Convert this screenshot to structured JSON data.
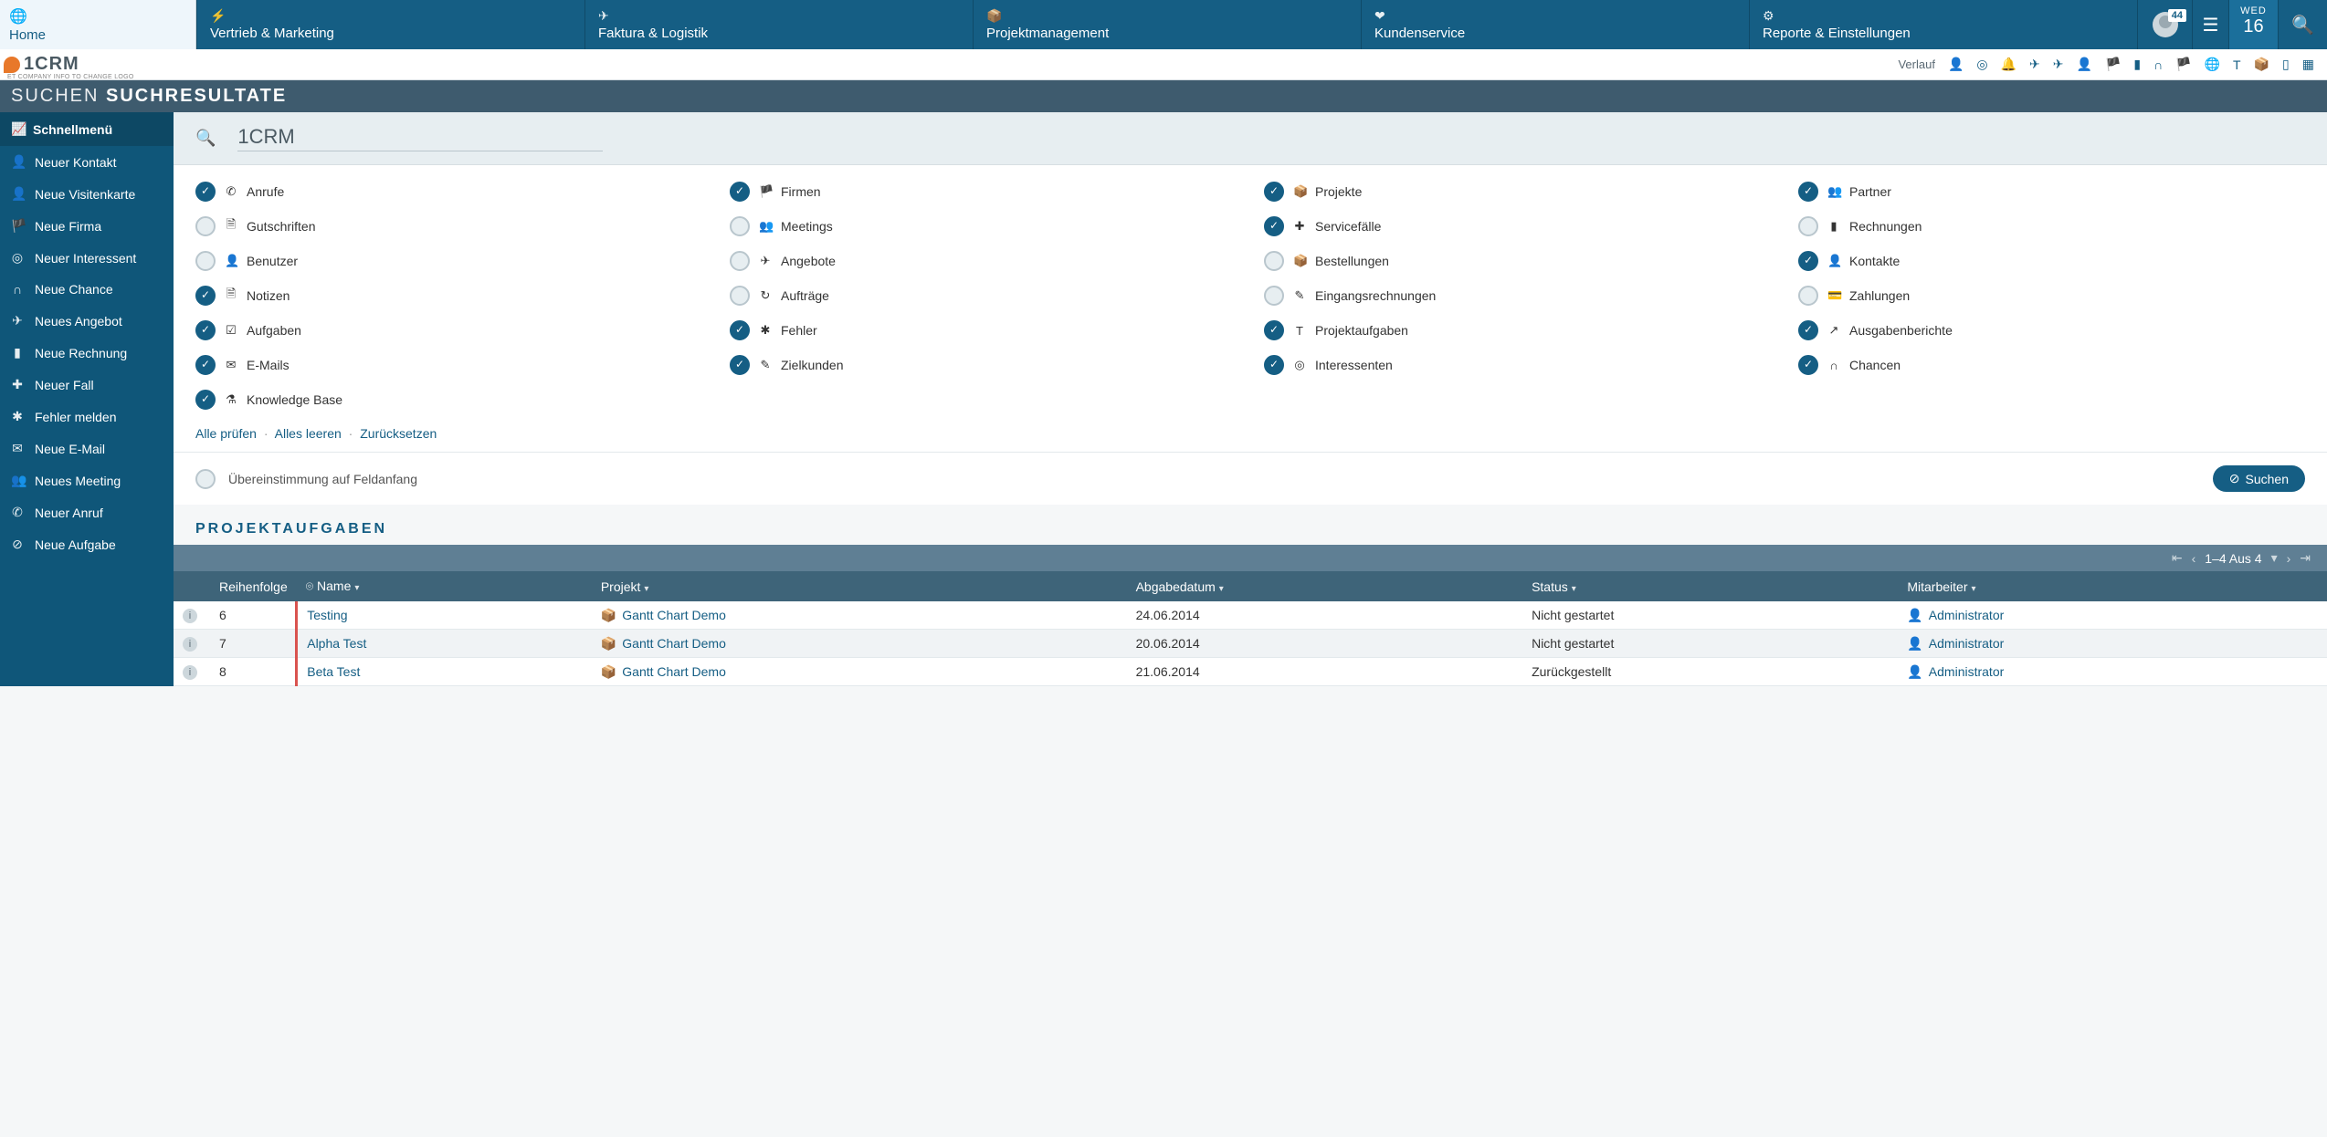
{
  "topnav": {
    "home": "Home",
    "items": [
      {
        "label": "Vertrieb & Marketing",
        "icon": "⚡"
      },
      {
        "label": "Faktura & Logistik",
        "icon": "✈"
      },
      {
        "label": "Projektmanagement",
        "icon": "📦"
      },
      {
        "label": "Kundenservice",
        "icon": "❤"
      },
      {
        "label": "Reporte & Einstellungen",
        "icon": "⚙"
      }
    ],
    "badge": "44",
    "weekday": "WED",
    "daynum": "16"
  },
  "logo": {
    "text": "1CRM",
    "sub": "ET COMPANY INFO TO CHANGE LOGO"
  },
  "history_label": "Verlauf",
  "pagetitle": {
    "thin": "SUCHEN",
    "bold": "SUCHRESULTATE"
  },
  "sidebar": {
    "header": "Schnellmenü",
    "items": [
      {
        "icon": "👤",
        "label": "Neuer Kontakt"
      },
      {
        "icon": "👤",
        "label": "Neue Visitenkarte"
      },
      {
        "icon": "🏴",
        "label": "Neue Firma"
      },
      {
        "icon": "◎",
        "label": "Neuer Interessent"
      },
      {
        "icon": "∩",
        "label": "Neue Chance"
      },
      {
        "icon": "✈",
        "label": "Neues Angebot"
      },
      {
        "icon": "▮",
        "label": "Neue Rechnung"
      },
      {
        "icon": "✚",
        "label": "Neuer Fall"
      },
      {
        "icon": "✱",
        "label": "Fehler melden"
      },
      {
        "icon": "✉",
        "label": "Neue E-Mail"
      },
      {
        "icon": "👥",
        "label": "Neues Meeting"
      },
      {
        "icon": "✆",
        "label": "Neuer Anruf"
      },
      {
        "icon": "⊘",
        "label": "Neue Aufgabe"
      }
    ]
  },
  "search": {
    "value": "1CRM"
  },
  "filters": [
    {
      "on": true,
      "icon": "✆",
      "label": "Anrufe"
    },
    {
      "on": true,
      "icon": "🏴",
      "label": "Firmen"
    },
    {
      "on": true,
      "icon": "📦",
      "label": "Projekte"
    },
    {
      "on": true,
      "icon": "👥",
      "label": "Partner"
    },
    {
      "on": false,
      "icon": "🗎",
      "label": "Gutschriften"
    },
    {
      "on": false,
      "icon": "👥",
      "label": "Meetings"
    },
    {
      "on": true,
      "icon": "✚",
      "label": "Servicefälle"
    },
    {
      "on": false,
      "icon": "▮",
      "label": "Rechnungen"
    },
    {
      "on": false,
      "icon": "👤",
      "label": "Benutzer"
    },
    {
      "on": false,
      "icon": "✈",
      "label": "Angebote"
    },
    {
      "on": false,
      "icon": "📦",
      "label": "Bestellungen"
    },
    {
      "on": true,
      "icon": "👤",
      "label": "Kontakte"
    },
    {
      "on": true,
      "icon": "🗎",
      "label": "Notizen"
    },
    {
      "on": false,
      "icon": "↻",
      "label": "Aufträge"
    },
    {
      "on": false,
      "icon": "✎",
      "label": "Eingangsrechnungen"
    },
    {
      "on": false,
      "icon": "💳",
      "label": "Zahlungen"
    },
    {
      "on": true,
      "icon": "☑",
      "label": "Aufgaben"
    },
    {
      "on": true,
      "icon": "✱",
      "label": "Fehler"
    },
    {
      "on": true,
      "icon": "T",
      "label": "Projektaufgaben"
    },
    {
      "on": true,
      "icon": "↗",
      "label": "Ausgabenberichte"
    },
    {
      "on": true,
      "icon": "✉",
      "label": "E-Mails"
    },
    {
      "on": true,
      "icon": "✎",
      "label": "Zielkunden"
    },
    {
      "on": true,
      "icon": "◎",
      "label": "Interessenten"
    },
    {
      "on": true,
      "icon": "∩",
      "label": "Chancen"
    },
    {
      "on": true,
      "icon": "⚗",
      "label": "Knowledge Base"
    }
  ],
  "filter_links": {
    "check_all": "Alle prüfen",
    "clear_all": "Alles leeren",
    "reset": "Zurücksetzen"
  },
  "match": {
    "label": "Übereinstimmung auf Feldanfang"
  },
  "search_button": "Suchen",
  "section_title": "PROJEKTAUFGABEN",
  "pager": {
    "range": "1–4 Aus 4"
  },
  "table": {
    "cols": {
      "order": "Reihenfolge",
      "name": "Name",
      "project": "Projekt",
      "due": "Abgabedatum",
      "status": "Status",
      "assignee": "Mitarbeiter"
    },
    "rows": [
      {
        "order": "6",
        "name": "Testing",
        "project": "Gantt Chart Demo",
        "due": "24.06.2014",
        "status": "Nicht gestartet",
        "assignee": "Administrator"
      },
      {
        "order": "7",
        "name": "Alpha Test",
        "project": "Gantt Chart Demo",
        "due": "20.06.2014",
        "status": "Nicht gestartet",
        "assignee": "Administrator"
      },
      {
        "order": "8",
        "name": "Beta Test",
        "project": "Gantt Chart Demo",
        "due": "21.06.2014",
        "status": "Zurückgestellt",
        "assignee": "Administrator"
      }
    ]
  }
}
